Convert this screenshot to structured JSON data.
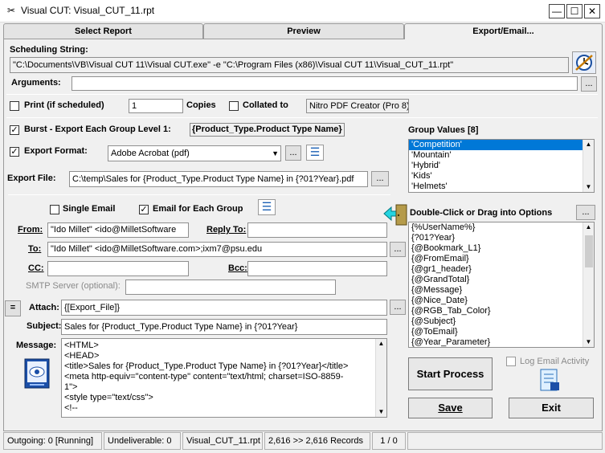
{
  "window": {
    "title": "Visual CUT:  Visual_CUT_11.rpt",
    "app_icon": "scissors-icon",
    "controls": [
      "—",
      "☐",
      "✕"
    ]
  },
  "tabs": [
    {
      "label": "Select Report"
    },
    {
      "label": "Preview"
    },
    {
      "label": "Export/Email..."
    }
  ],
  "scheduling": {
    "label": "Scheduling String:",
    "value": "\"C:\\Documents\\VB\\Visual CUT 11\\Visual CUT.exe\" -e \"C:\\Program Files (x86)\\Visual CUT 11\\Visual_CUT_11.rpt\"",
    "arguments_label": "Arguments:",
    "arguments_value": "",
    "browse": "..."
  },
  "print": {
    "label": "Print (if scheduled)",
    "checked": false,
    "copies_value": "1",
    "copies_label": "Copies",
    "collated_label": "Collated to",
    "collated_checked": false,
    "printer": "Nitro PDF Creator (Pro 8)"
  },
  "burst": {
    "label": "Burst - Export Each Group Level 1:",
    "checked": true,
    "group_field": "{Product_Type.Product Type Name}"
  },
  "export": {
    "format_label": "Export Format:",
    "format_checked": true,
    "format_value": "Adobe Acrobat (pdf)",
    "file_label": "Export File:",
    "file_value": "C:\\temp\\Sales for {Product_Type.Product Type Name} in {?01?Year}.pdf",
    "browse": "..."
  },
  "group_values": {
    "label": "Group Values [8]",
    "items": [
      "'Competition'",
      "'Mountain'",
      "'Hybrid'",
      "'Kids'",
      "'Helmets'"
    ],
    "selected_index": 0
  },
  "email": {
    "single_label": "Single Email",
    "single_checked": false,
    "each_group_label": "Email for Each Group",
    "each_group_checked": true,
    "from_label": "From:",
    "from_value": "\"Ido Millet\" <ido@MilletSoftware",
    "reply_to_label": "Reply To:",
    "reply_to_value": "",
    "to_label": "To:",
    "to_value": "\"Ido Millet\" <ido@MilletSoftware.com>;ixm7@psu.edu",
    "cc_label": "CC:",
    "cc_value": "",
    "bcc_label": "Bcc:",
    "bcc_value": "",
    "smtp_label": "SMTP Server (optional):",
    "smtp_value": "",
    "attach_eq": "=",
    "attach_label": "Attach:",
    "attach_value": "{[Export_File]}",
    "subject_label": "Subject:",
    "subject_value": "Sales for {Product_Type.Product Type Name} in {?01?Year}",
    "message_label": "Message:",
    "message_lines": [
      "<HTML>",
      "<HEAD>",
      "<title>Sales for {Product_Type.Product Type Name} in {?01?Year}</title>",
      "<meta http-equiv=\"content-type\" content=\"text/html; charset=ISO-8859-",
      "1\">",
      "<style type=\"text/css\">",
      "<!--"
    ]
  },
  "options": {
    "label": "Double-Click or Drag into Options",
    "items": [
      "{%UserName%}",
      "{?01?Year}",
      "{@Bookmark_L1}",
      "{@FromEmail}",
      "{@gr1_header}",
      "{@GrandTotal}",
      "{@Message}",
      "{@Nice_Date}",
      "{@RGB_Tab_Color}",
      "{@Subject}",
      "{@ToEmail}",
      "{@Year_Parameter}"
    ]
  },
  "actions": {
    "start_process": "Start Process",
    "log_email": "Log Email Activity",
    "log_checked": false,
    "save": "Save",
    "exit": "Exit"
  },
  "status": {
    "outgoing": "Outgoing: 0 [Running]",
    "undeliverable": "Undeliverable: 0",
    "report": "Visual_CUT_11.rpt",
    "records": "2,616 >> 2,616 Records",
    "pages": "1 / 0"
  }
}
